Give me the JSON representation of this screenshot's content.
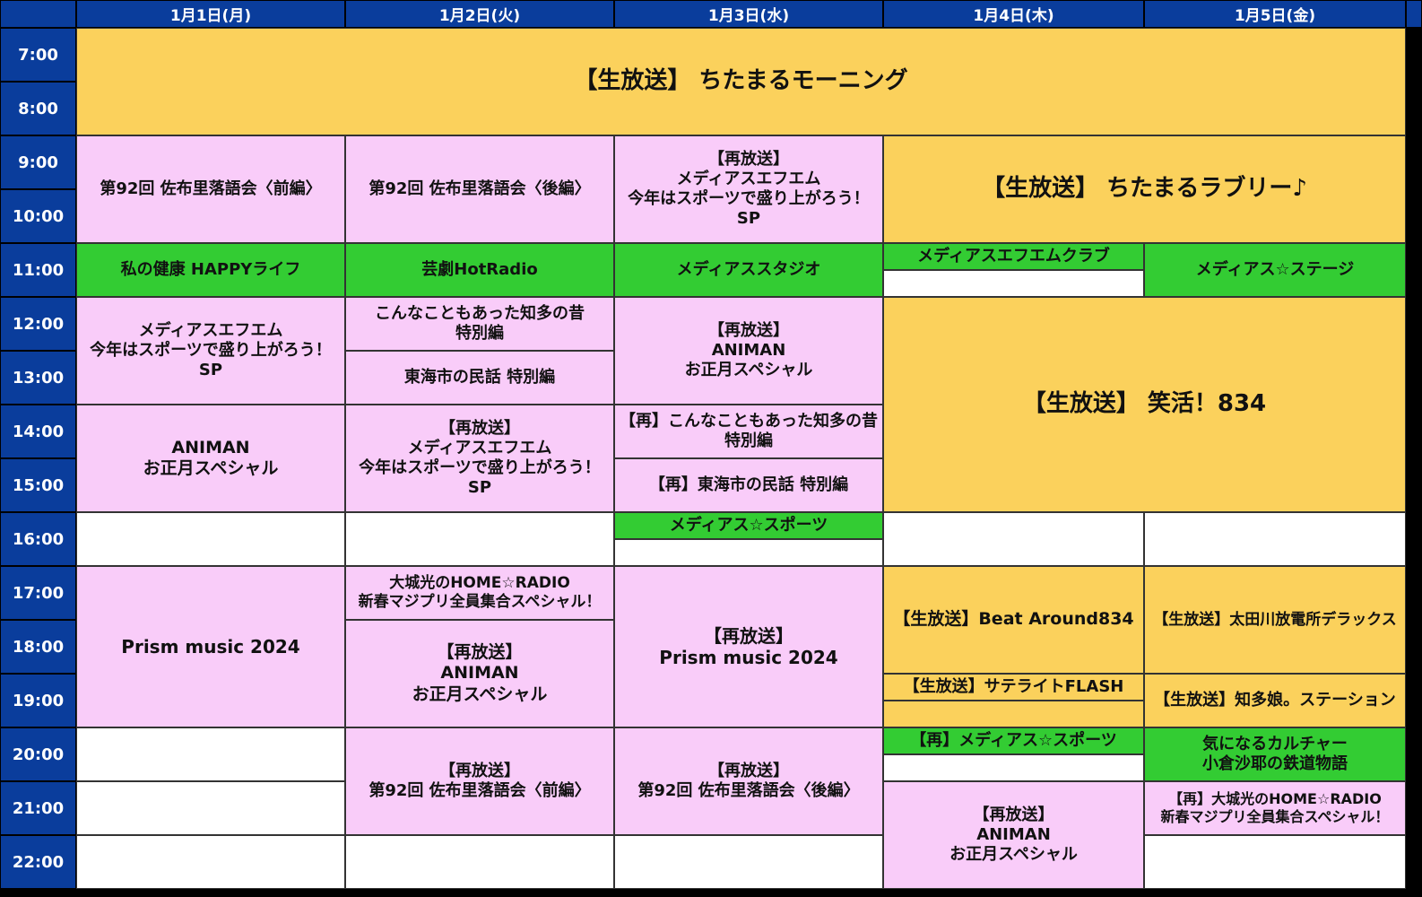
{
  "days": [
    "1月1日(月)",
    "1月2日(火)",
    "1月3日(水)",
    "1月4日(木)",
    "1月5日(金)"
  ],
  "times": [
    "7:00",
    "8:00",
    "9:00",
    "10:00",
    "11:00",
    "12:00",
    "13:00",
    "14:00",
    "15:00",
    "16:00",
    "17:00",
    "18:00",
    "19:00",
    "20:00",
    "21:00",
    "22:00"
  ],
  "colors": {
    "header": "#0a3d9c",
    "pink": "#f9ccf9",
    "yellow": "#fbd15c",
    "green": "#33cc33",
    "white": "#ffffff"
  },
  "programs": {
    "p01": {
      "lines": [
        "【生放送】 ちたまるモーニング"
      ]
    },
    "p02": {
      "lines": [
        "第92回 佐布里落語会〈前編〉"
      ]
    },
    "p03": {
      "lines": [
        "第92回 佐布里落語会〈後編〉"
      ]
    },
    "p04": {
      "lines": [
        "【再放送】",
        "メディアスエフエム",
        "今年はスポーツで盛り上がろう！",
        "SP"
      ]
    },
    "p05": {
      "lines": [
        "【生放送】 ちたまるラブリー♪"
      ]
    },
    "p06": {
      "lines": [
        "私の健康 HAPPYライフ"
      ]
    },
    "p07": {
      "lines": [
        "芸劇HotRadio"
      ]
    },
    "p08": {
      "lines": [
        "メディアススタジオ"
      ]
    },
    "p09": {
      "lines": [
        "メディアスエフエムクラブ"
      ]
    },
    "p10": {
      "lines": [
        ""
      ]
    },
    "p11": {
      "lines": [
        "メディアス☆ステージ"
      ]
    },
    "p12": {
      "lines": [
        "メディアスエフエム",
        "今年はスポーツで盛り上がろう！",
        "SP"
      ]
    },
    "p13": {
      "lines": [
        "こんなこともあった知多の昔",
        "特別編"
      ]
    },
    "p14": {
      "lines": [
        "東海市の民話 特別編"
      ]
    },
    "p15": {
      "lines": [
        "【再放送】",
        "ANIMAN",
        "お正月スペシャル"
      ]
    },
    "p16": {
      "lines": [
        "【生放送】 笑活！834"
      ]
    },
    "p17": {
      "lines": [
        "ANIMAN",
        "お正月スペシャル"
      ]
    },
    "p18": {
      "lines": [
        "【再放送】",
        "メディアスエフエム",
        "今年はスポーツで盛り上がろう！",
        "SP"
      ]
    },
    "p19": {
      "lines": [
        "【再】こんなこともあった知多の昔",
        "特別編"
      ]
    },
    "p20": {
      "lines": [
        "【再】東海市の民話 特別編"
      ]
    },
    "p21": {
      "lines": [
        ""
      ]
    },
    "p22": {
      "lines": [
        ""
      ]
    },
    "p23": {
      "lines": [
        "メディアス☆スポーツ"
      ]
    },
    "p24": {
      "lines": [
        ""
      ]
    },
    "p25": {
      "lines": [
        ""
      ]
    },
    "p26": {
      "lines": [
        ""
      ]
    },
    "p27": {
      "lines": [
        "Prism music 2024"
      ]
    },
    "p28": {
      "lines": [
        "大城光のHOME☆RADIO",
        "新春マジプリ全員集合スペシャル！"
      ]
    },
    "p29": {
      "lines": [
        "【再放送】",
        "ANIMAN",
        "お正月スペシャル"
      ]
    },
    "p30": {
      "lines": [
        "【再放送】",
        "Prism music 2024"
      ]
    },
    "p31": {
      "lines": [
        "【生放送】Beat Around834"
      ]
    },
    "p32": {
      "lines": [
        "【生放送】太田川放電所デラックス"
      ]
    },
    "p33": {
      "lines": [
        "【生放送】サテライトFLASH"
      ]
    },
    "p34": {
      "lines": [
        ""
      ]
    },
    "p35": {
      "lines": [
        "【生放送】知多娘。ステーション"
      ]
    },
    "p36": {
      "lines": [
        ""
      ]
    },
    "p37": {
      "lines": [
        ""
      ]
    },
    "p38": {
      "lines": [
        "【再放送】",
        "第92回 佐布里落語会〈前編〉"
      ]
    },
    "p39": {
      "lines": [
        "【再放送】",
        "第92回 佐布里落語会〈後編〉"
      ]
    },
    "p40": {
      "lines": [
        "【再】メディアス☆スポーツ"
      ]
    },
    "p41": {
      "lines": [
        ""
      ]
    },
    "p42": {
      "lines": [
        "気になるカルチャー",
        "小倉沙耶の鉄道物語"
      ]
    },
    "p43": {
      "lines": [
        "【再放送】",
        "ANIMAN",
        "お正月スペシャル"
      ]
    },
    "p44": {
      "lines": [
        "【再】大城光のHOME☆RADIO",
        "新春マジプリ全員集合スペシャル！"
      ]
    },
    "p45": {
      "lines": [
        ""
      ]
    },
    "p46": {
      "lines": [
        ""
      ]
    }
  }
}
